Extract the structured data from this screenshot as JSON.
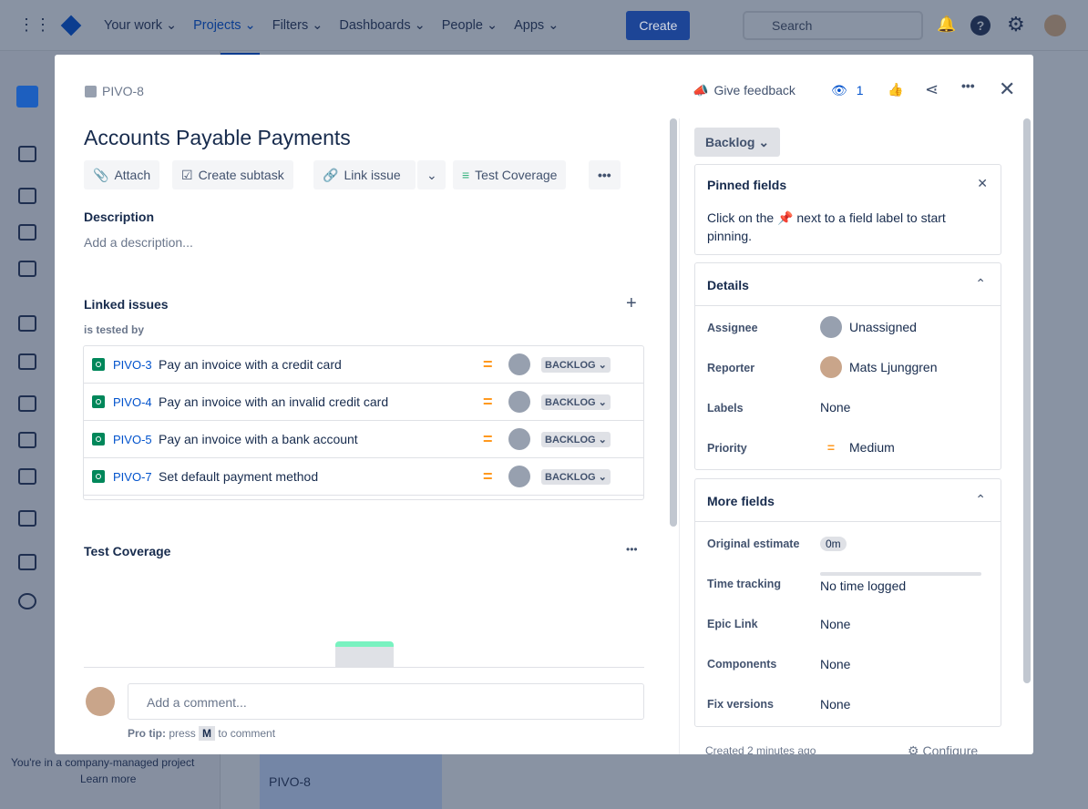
{
  "nav": {
    "items": [
      "Your work",
      "Projects",
      "Filters",
      "Dashboards",
      "People",
      "Apps"
    ],
    "active": "Projects",
    "create": "Create",
    "search_placeholder": "Search"
  },
  "background": {
    "sidebar_notice": "You're in a company-managed project",
    "learn_more": "Learn more",
    "card_key": "PIVO-8"
  },
  "issue": {
    "key": "PIVO-8",
    "title": "Accounts Payable Payments",
    "give_feedback": "Give feedback",
    "watchers": "1",
    "actions": {
      "attach": "Attach",
      "create_subtask": "Create subtask",
      "link_issue": "Link issue",
      "test_coverage": "Test Coverage"
    },
    "description_label": "Description",
    "description_placeholder": "Add a description...",
    "linked_label": "Linked issues",
    "link_type": "is tested by",
    "linked": [
      {
        "key": "PIVO-3",
        "summary": "Pay an invoice with a credit card",
        "status": "BACKLOG"
      },
      {
        "key": "PIVO-4",
        "summary": "Pay an invoice with an invalid credit card",
        "status": "BACKLOG"
      },
      {
        "key": "PIVO-5",
        "summary": "Pay an invoice with a bank account",
        "status": "BACKLOG"
      },
      {
        "key": "PIVO-7",
        "summary": "Set default payment method",
        "status": "BACKLOG"
      }
    ],
    "test_coverage_label": "Test Coverage",
    "comment_placeholder": "Add a comment...",
    "pro_tip": "Pro tip:",
    "pro_tip_rest1": "press",
    "pro_tip_key": "M",
    "pro_tip_rest2": "to comment"
  },
  "side": {
    "status": "Backlog",
    "pinned_title": "Pinned fields",
    "pinned_text1": "Click on the",
    "pinned_text2": "next to a field label to start pinning.",
    "details_title": "Details",
    "details": [
      {
        "label": "Assignee",
        "value": "Unassigned"
      },
      {
        "label": "Reporter",
        "value": "Mats Ljunggren"
      },
      {
        "label": "Labels",
        "value": "None"
      },
      {
        "label": "Priority",
        "value": "Medium"
      }
    ],
    "more_title": "More fields",
    "more": [
      {
        "label": "Original estimate",
        "value": "0m"
      },
      {
        "label": "Time tracking",
        "value": "No time logged"
      },
      {
        "label": "Epic Link",
        "value": "None"
      },
      {
        "label": "Components",
        "value": "None"
      },
      {
        "label": "Fix versions",
        "value": "None"
      }
    ],
    "created": "Created 2 minutes ago",
    "configure": "Configure"
  },
  "colors": {
    "accent": "#0052cc",
    "priority_medium": "#ff991f",
    "test_icon": "#00875a"
  }
}
